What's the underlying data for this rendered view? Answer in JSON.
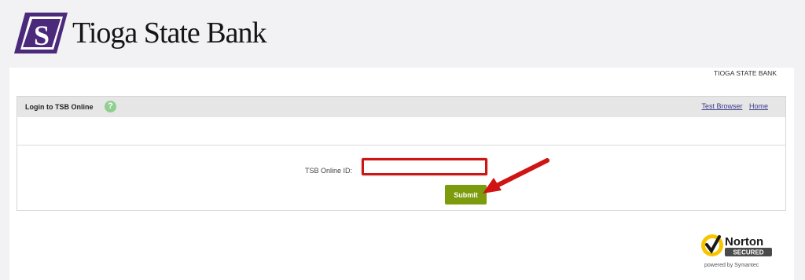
{
  "brand": {
    "logo_letter": "S",
    "name": "Tioga State Bank",
    "colors": {
      "logo_purple": "#4b2a7b",
      "button_green": "#7c9c0e",
      "input_border": "#d01313"
    }
  },
  "page": {
    "bank_name_caption": "TIOGA STATE BANK"
  },
  "login": {
    "title": "Login to TSB Online",
    "help_icon": "?",
    "links": {
      "test_browser": "Test Browser",
      "home": "Home"
    },
    "id_label": "TSB Online ID:",
    "id_value": "",
    "submit_label": "Submit"
  },
  "badge": {
    "name": "Norton",
    "secured": "SECURED",
    "powered_by": "powered by Symantec"
  }
}
